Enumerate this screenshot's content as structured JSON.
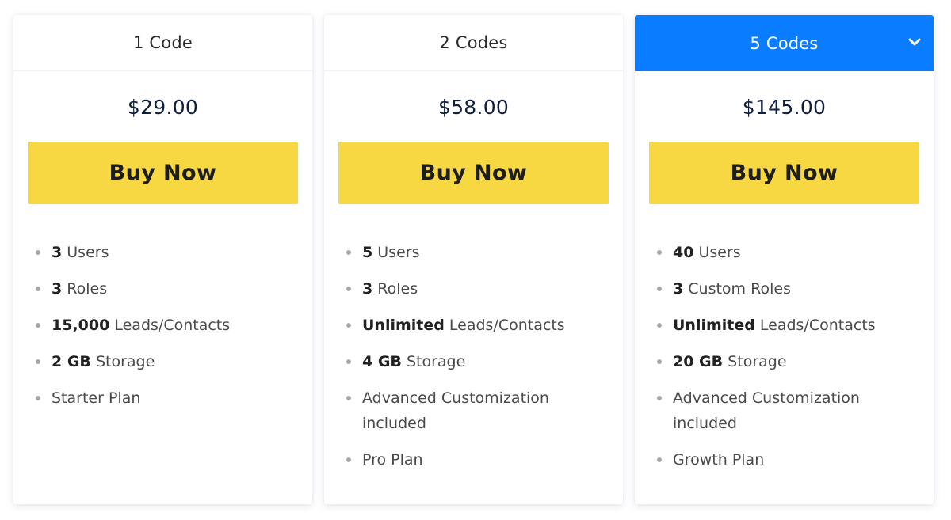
{
  "accent_color": "#0a7cff",
  "button_color": "#f7d842",
  "plans": [
    {
      "header": "1 Code",
      "price": "$29.00",
      "button_label": "Buy Now",
      "active": false,
      "features": [
        {
          "bold": "3",
          "text": " Users"
        },
        {
          "bold": "3",
          "text": " Roles"
        },
        {
          "bold": "15,000",
          "text": " Leads/Contacts"
        },
        {
          "bold": "2 GB",
          "text": " Storage"
        },
        {
          "bold": "",
          "text": "Starter Plan"
        }
      ]
    },
    {
      "header": "2 Codes",
      "price": "$58.00",
      "button_label": "Buy Now",
      "active": false,
      "features": [
        {
          "bold": "5",
          "text": " Users"
        },
        {
          "bold": "3",
          "text": " Roles"
        },
        {
          "bold": "Unlimited",
          "text": " Leads/Contacts"
        },
        {
          "bold": "4 GB",
          "text": " Storage"
        },
        {
          "bold": "",
          "text": "Advanced Customization included"
        },
        {
          "bold": "",
          "text": "Pro Plan"
        }
      ]
    },
    {
      "header": "5 Codes",
      "price": "$145.00",
      "button_label": "Buy Now",
      "active": true,
      "header_icon": "chevron-down-icon",
      "features": [
        {
          "bold": "40",
          "text": " Users"
        },
        {
          "bold": "3",
          "text": " Custom Roles"
        },
        {
          "bold": "Unlimited",
          "text": " Leads/Contacts"
        },
        {
          "bold": "20 GB",
          "text": " Storage"
        },
        {
          "bold": "",
          "text": "Advanced Customization included"
        },
        {
          "bold": "",
          "text": "Growth Plan"
        }
      ]
    }
  ]
}
